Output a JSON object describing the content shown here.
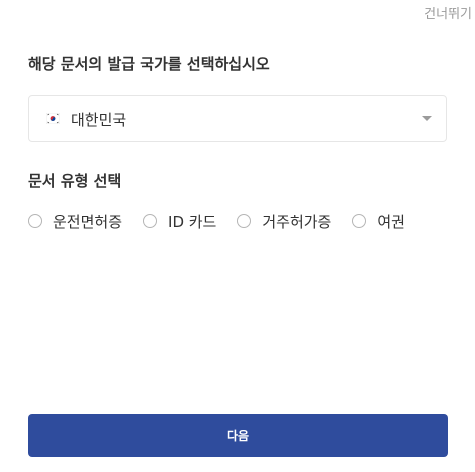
{
  "header": {
    "skip_label": "건너뛰기"
  },
  "country_section": {
    "title": "해당 문서의 발급 국가를 선택하십시오",
    "selected_country": "대한민국",
    "flag_icon": "south-korea-flag-icon"
  },
  "document_section": {
    "title": "문서 유형 선택",
    "options": [
      {
        "label": "운전면허증",
        "selected": false
      },
      {
        "label": "ID 카드",
        "selected": false
      },
      {
        "label": "거주허가증",
        "selected": false
      },
      {
        "label": "여권",
        "selected": false
      }
    ]
  },
  "footer": {
    "next_label": "다음"
  },
  "colors": {
    "accent": "#2f4c9d",
    "text": "#333333",
    "muted": "#9a9a9a",
    "border": "#e6e6e6"
  }
}
